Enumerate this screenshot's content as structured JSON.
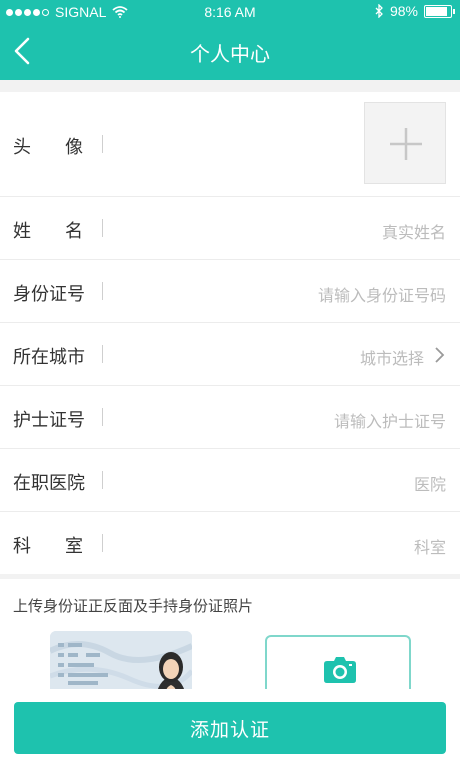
{
  "status_bar": {
    "carrier": "SIGNAL",
    "time": "8:16 AM",
    "battery": "98%",
    "signal_icon": "signal-dots-icon",
    "wifi_icon": "wifi-icon",
    "bluetooth_icon": "bluetooth-icon",
    "battery_icon": "battery-icon"
  },
  "header": {
    "title": "个人中心",
    "back_icon": "chevron-left-icon",
    "color": "#1ec2ae"
  },
  "form": {
    "avatar": {
      "label": "头像",
      "add_icon": "plus-icon"
    },
    "name": {
      "label": "姓名",
      "placeholder": "真实姓名"
    },
    "id_number": {
      "label": "身份证号",
      "placeholder": "请输入身份证号码"
    },
    "city": {
      "label": "所在城市",
      "placeholder": "城市选择",
      "icon": "chevron-right-icon"
    },
    "nurse_cert": {
      "label": "护士证号",
      "placeholder": "请输入护士证号"
    },
    "hospital": {
      "label": "在职医院",
      "placeholder": "医院"
    },
    "department": {
      "label": "科室",
      "placeholder": "科室"
    }
  },
  "upload": {
    "title": "上传身份证正反面及手持身份证照片",
    "sample_image": "id-card-sample",
    "camera_icon": "camera-icon"
  },
  "footer": {
    "submit_label": "添加认证"
  }
}
